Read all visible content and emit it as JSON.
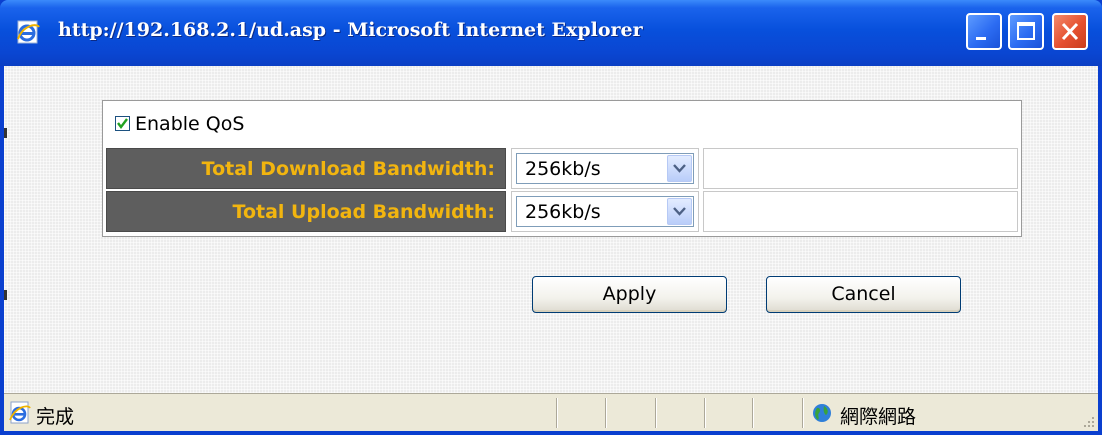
{
  "window": {
    "title": "http://192.168.2.1/ud.asp - Microsoft Internet Explorer",
    "controls": {
      "minimize_icon": "minimize-icon",
      "maximize_icon": "maximize-icon",
      "close_icon": "close-icon"
    }
  },
  "qos": {
    "enable_label": "Enable QoS",
    "enabled": true,
    "download": {
      "label": "Total Download Bandwidth:",
      "value": "256kb/s"
    },
    "upload": {
      "label": "Total Upload Bandwidth:",
      "value": "256kb/s"
    }
  },
  "buttons": {
    "apply": "Apply",
    "cancel": "Cancel"
  },
  "statusbar": {
    "status": "完成",
    "zone": "網際網路"
  },
  "colors": {
    "titlebar": "#0a46d2",
    "label_bg": "#5e5e5e",
    "label_text": "#f2b50f",
    "close_button": "#e5502f"
  }
}
